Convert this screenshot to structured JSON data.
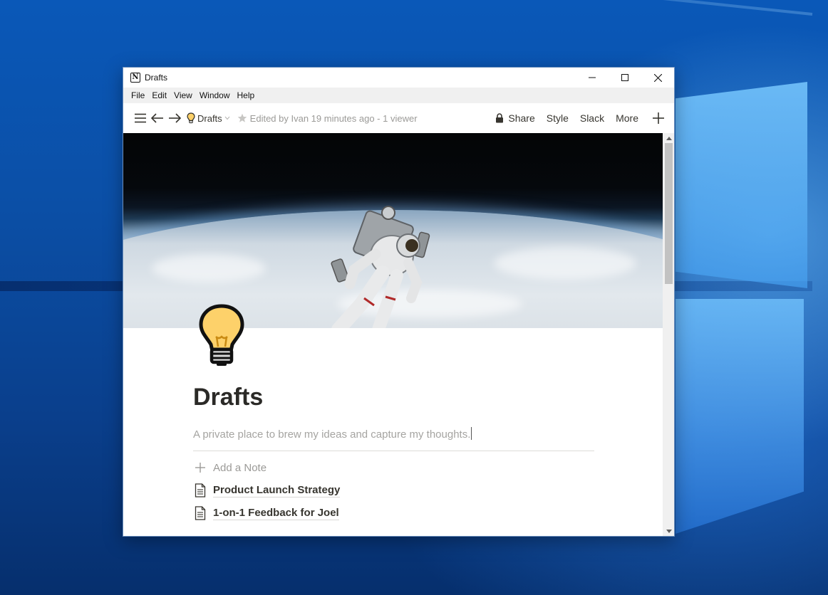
{
  "window": {
    "title": "Drafts",
    "controls": [
      "minimize",
      "maximize",
      "close"
    ]
  },
  "menubar": {
    "items": [
      "File",
      "Edit",
      "View",
      "Window",
      "Help"
    ]
  },
  "toolbar": {
    "breadcrumb_icon": "lightbulb-icon",
    "breadcrumb_label": "Drafts",
    "edited_text": "Edited by Ivan 19 minutes ago - 1 viewer",
    "share_label": "Share",
    "style_label": "Style",
    "slack_label": "Slack",
    "more_label": "More"
  },
  "page": {
    "cover_image": "astronaut-in-space-above-earth",
    "icon": "lightbulb-icon",
    "title": "Drafts",
    "description": "A private place to brew my ideas and capture my thoughts.",
    "add_note_label": "Add a Note",
    "documents": [
      {
        "title": "Product Launch Strategy",
        "icon": "document-icon"
      },
      {
        "title": "1-on-1 Feedback for Joel",
        "icon": "document-icon"
      }
    ]
  },
  "colors": {
    "text_primary": "#37352f",
    "text_muted": "#9b9a97",
    "bulb_yellow": "#fdd16a"
  }
}
